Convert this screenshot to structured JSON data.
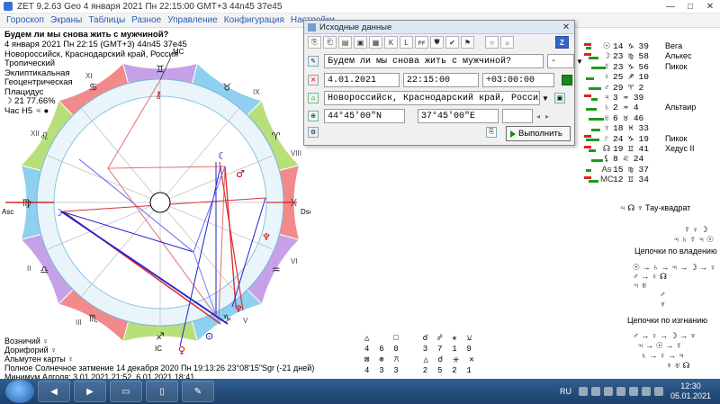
{
  "window": {
    "title": "ZET 9.2.63 Geo    4 января 2021  Пн  22:15:00 GMT+3 44n45  37e45",
    "controls": [
      "—",
      "□",
      "✕"
    ]
  },
  "menu": [
    "Гороскоп",
    "Экраны",
    "Таблицы",
    "Разное",
    "Управление",
    "Конфигурация",
    "Настройки"
  ],
  "info": {
    "question": "Будем ли мы снова жить с мужчиной?",
    "datetime": "4 января 2021  Пн  22:15 (GMT+3) 44n45  37e45",
    "place": "Новороссийск, Краснодарский край, Россия"
  },
  "modes": [
    "Тропический",
    "Эклиптикальная",
    "Геоцентрическая",
    "Плацидус"
  ],
  "moon_phase": "☽  21 77.66%",
  "hour_label": "Час Н5  ♃  ●",
  "chart": {
    "axis_asc": "Asc",
    "axis_dsc": "Dsc",
    "axis_mc": "MC",
    "axis_ic": "IC",
    "houses": [
      "XII",
      "XI",
      "IX",
      "VIII",
      "VI",
      "V",
      "III",
      "II"
    ],
    "zodiac_signs": [
      "♍",
      "♌",
      "♋",
      "♊",
      "♉",
      "♈",
      "♓",
      "♒",
      "♑",
      "♐",
      "♏",
      "♎"
    ],
    "colors": {
      "fire": "#f38a8a",
      "earth": "#b7e07a",
      "air": "#8fd0f0",
      "water": "#c7a1e8"
    }
  },
  "bottom_left": {
    "lines": [
      "Возничий  ♀",
      "Дорифорий  ♀",
      "Альмутен карты  ♀",
      "Полное Солнечное затмение 14 декабря 2020 Пн 19:13:26 23°08'15\"Sgr (-21 дней)",
      "Минимум Алголя: 3.01.2021 21:52,  6.01.2021 18:41"
    ]
  },
  "dialog": {
    "title": "Исходные данные",
    "close": "✕",
    "toolbar_icons": [
      "copy-icon",
      "paste-icon",
      "save-icon",
      "open-icon",
      "table-icon",
      "k-icon",
      "l-icon",
      "pf-icon",
      "shield-icon",
      "check-icon",
      "flag-icon",
      "circle-icon",
      "sun-icon",
      "z-icon"
    ],
    "toolbar_labels": [
      "⎘",
      "⎗",
      "▤",
      "▣",
      "▦",
      "K",
      "L",
      "ᴘꜰ",
      "⛊",
      "✔",
      "⚑",
      "○",
      "☼",
      "Z"
    ],
    "question": "Будем ли мы снова жить с мужчиной?",
    "question_sign": "-",
    "date": "4.01.2021",
    "time": "22:15:00",
    "tz": "+03:00:00",
    "place": "Новороссийск, Краснодарский край, Россия",
    "lat": "44°45'00\"N",
    "lon": "37°45'00\"E",
    "run_label": "Выполнить"
  },
  "planets": [
    {
      "sym": "☉",
      "pos": "14 ♑ 39",
      "star": "Вега"
    },
    {
      "sym": "☽",
      "pos": "23 ♍ 58",
      "star": "Алькес"
    },
    {
      "sym": "☿",
      "pos": "23 ♑ 56",
      "star": "Пикок"
    },
    {
      "sym": "♀",
      "pos": "25 ♐ 10",
      "star": ""
    },
    {
      "sym": "♂",
      "pos": "29 ♈ 2",
      "star": ""
    },
    {
      "sym": "♃",
      "pos": "3 ♒ 39",
      "star": ""
    },
    {
      "sym": "♄",
      "pos": "2 ♒ 4",
      "star": "Альтаир"
    },
    {
      "sym": "♅",
      "pos": "6 ♉ 46",
      "star": ""
    },
    {
      "sym": "♆",
      "pos": "18 ♓ 33",
      "star": ""
    },
    {
      "sym": "♇",
      "pos": "24 ♑ 19",
      "star": "Пикок"
    },
    {
      "sym": "☊",
      "pos": "19 ♊ 41",
      "star": "Хедус II"
    },
    {
      "sym": "⚸",
      "pos": "8 ♌ 24",
      "star": ""
    },
    {
      "sym": "As",
      "pos": "15 ♍ 37",
      "star": ""
    },
    {
      "sym": "MC",
      "pos": "12 ♊ 34",
      "star": ""
    }
  ],
  "right_extra": {
    "tau_square": "♃ ☊ ♆  Тау-квадрат",
    "small1": "☿ ♀ ☽",
    "small2": "♃ ♄ ☿ ♃ ☉",
    "chain_own": "Цепочки по владению",
    "chain_own_l1": "☉ → ♄ → ♃ → ☽ → ♀",
    "chain_own_l2": "♂ → ♀  ☊",
    "chain_own_l3": "♃ ♅",
    "chain_own_l4": "♂",
    "chain_own_l5": "♆",
    "chain_exile": "Цепочки по изгнанию",
    "chain_exile_l1": "♂ → ♀ → ☽ → ♆",
    "chain_exile_l2": "♃ → ☉ → ☿",
    "chain_exile_l3": "♄ → ♀ → ♃",
    "chain_exile_l4": "♆ ♅ ☊"
  },
  "aspects": {
    "row1": "△     □     ☌  ☍  ⚹  ⚺",
    "row2": "4  6  0     3  7  1  9",
    "row3": "⊠  ⊗  ⚻     △  ☌  ⚹  ✕",
    "row4": "4  3  3     2  5  2  1"
  },
  "taskbar": {
    "lang": "RU",
    "time": "12:30",
    "date": "05.01.2021"
  }
}
